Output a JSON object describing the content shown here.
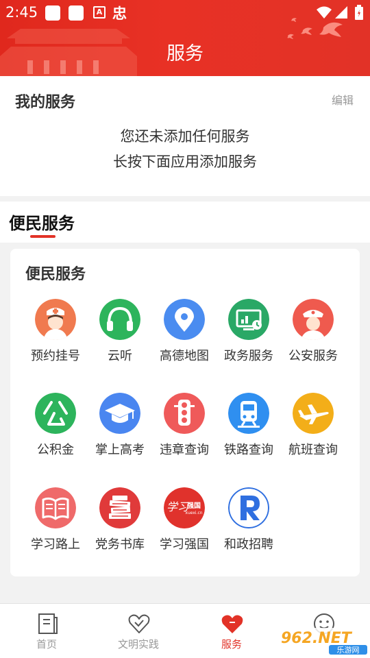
{
  "status_bar": {
    "time": "2:45",
    "icons": [
      "notification-square",
      "notification-square",
      "a-icon",
      "zhong-icon",
      "wifi-icon",
      "signal-icon",
      "battery-icon"
    ],
    "a_glyph": "A",
    "zhong_glyph": "忠"
  },
  "header": {
    "title": "服务"
  },
  "my_services": {
    "title": "我的服务",
    "edit_label": "编辑",
    "empty_line1": "您还未添加任何服务",
    "empty_line2": "长按下面应用添加服务"
  },
  "category_tab": {
    "label": "便民服务"
  },
  "services": {
    "title": "便民服务",
    "items": [
      {
        "label": "预约挂号",
        "icon": "nurse-icon",
        "color": "#f07a4f"
      },
      {
        "label": "云听",
        "icon": "headphones-icon",
        "color": "#2db45c"
      },
      {
        "label": "高德地图",
        "icon": "map-pin-icon",
        "color": "#4a8cf0"
      },
      {
        "label": "政务服务",
        "icon": "gov-screen-icon",
        "color": "#2aa866"
      },
      {
        "label": "公安服务",
        "icon": "police-icon",
        "color": "#ef5a4e"
      },
      {
        "label": "公积金",
        "icon": "gongjijin-icon",
        "color": "#2db45c"
      },
      {
        "label": "掌上高考",
        "icon": "graduation-cap-icon",
        "color": "#4a86f0"
      },
      {
        "label": "违章查询",
        "icon": "traffic-light-icon",
        "color": "#ef5a5a"
      },
      {
        "label": "铁路查询",
        "icon": "train-icon",
        "color": "#2f8ff0"
      },
      {
        "label": "航班查询",
        "icon": "airplane-icon",
        "color": "#f3ae19"
      },
      {
        "label": "学习路上",
        "icon": "open-book-icon",
        "color": "#ef6a6a"
      },
      {
        "label": "党务书库",
        "icon": "book-stack-icon",
        "color": "#e03a3a"
      },
      {
        "label": "学习强国",
        "icon": "xuexi-logo-icon",
        "color": "#e0322c",
        "logo_text": "学习强国",
        "logo_sub": "xuexi.cn"
      },
      {
        "label": "和政招聘",
        "icon": "letter-r-icon",
        "color": "#2f6fe0"
      }
    ]
  },
  "bottom_nav": {
    "items": [
      {
        "label": "首页",
        "icon": "home-doc-icon",
        "active": false
      },
      {
        "label": "文明实践",
        "icon": "heart-icon",
        "active": false
      },
      {
        "label": "服务",
        "icon": "service-heart-icon",
        "active": true
      },
      {
        "label": "",
        "icon": "smiley-icon",
        "active": false
      }
    ]
  },
  "watermark": {
    "text": "962.NET",
    "sub": "乐游网"
  },
  "colors": {
    "primary_red": "#e23227",
    "text_dark": "#333333",
    "text_gray": "#999999",
    "background": "#f2f2f2"
  }
}
